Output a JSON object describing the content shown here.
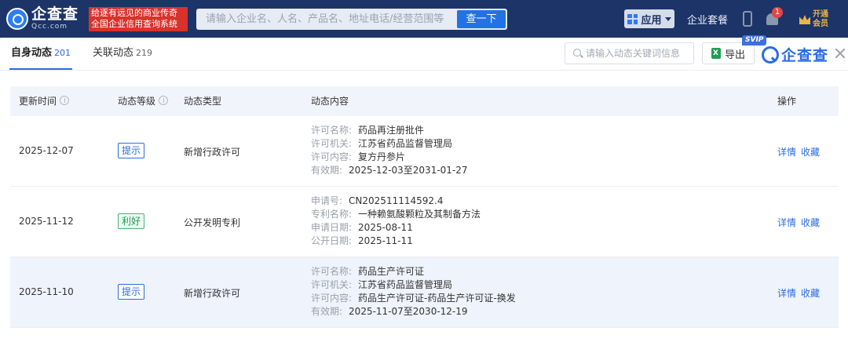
{
  "header": {
    "logo_cn": "企查查",
    "logo_en": "Qcc.com",
    "slogan_line1": "给逐有远见的商业传奇",
    "slogan_line2": "全国企业信用查询系统",
    "search_placeholder": "请输入企业名、人名、产品名、地址电话/经营范围等",
    "search_button": "查一下",
    "app_label": "应用",
    "package_label": "企业套餐",
    "notification_count": "1",
    "vip_label": "开通会员"
  },
  "tabs": [
    {
      "label": "自身动态",
      "count": "201",
      "active": true
    },
    {
      "label": "关联动态",
      "count": "219",
      "active": false
    }
  ],
  "toolbar": {
    "keyword_placeholder": "请输入动态关键词信息",
    "export_label": "导出",
    "svip_badge": "SVIP",
    "brand_text": "企查查"
  },
  "table": {
    "headers": {
      "time": "更新时间",
      "level": "动态等级",
      "type": "动态类型",
      "content": "动态内容",
      "ops": "操作"
    },
    "rows": [
      {
        "date": "2025-12-07",
        "level": "提示",
        "type": "新增行政许可",
        "content": [
          {
            "k": "许可名称:",
            "v": "药品再注册批件"
          },
          {
            "k": "许可机关:",
            "v": "江苏省药品监督管理局"
          },
          {
            "k": "许可内容:",
            "v": "复方丹参片"
          },
          {
            "k": "有效期:",
            "v": "2025-12-03至2031-01-27"
          }
        ],
        "ops": [
          "详情",
          "收藏"
        ]
      },
      {
        "date": "2025-11-12",
        "level": "利好",
        "type": "公开发明专利",
        "content": [
          {
            "k": "申请号:",
            "v": "CN202511114592.4"
          },
          {
            "k": "专利名称:",
            "v": "一种赖氨酸颗粒及其制备方法"
          },
          {
            "k": "申请日期:",
            "v": "2025-08-11"
          },
          {
            "k": "公开日期:",
            "v": "2025-11-11"
          }
        ],
        "ops": [
          "详情",
          "收藏"
        ]
      },
      {
        "date": "2025-11-10",
        "level": "提示",
        "type": "新增行政许可",
        "content": [
          {
            "k": "许可名称:",
            "v": "药品生产许可证"
          },
          {
            "k": "许可机关:",
            "v": "江苏省药品监督管理局"
          },
          {
            "k": "许可内容:",
            "v": "药品生产许可证-药品生产许可证-换发"
          },
          {
            "k": "有效期:",
            "v": "2025-11-07至2030-12-19"
          }
        ],
        "ops": [
          "详情",
          "收藏"
        ]
      }
    ]
  }
}
